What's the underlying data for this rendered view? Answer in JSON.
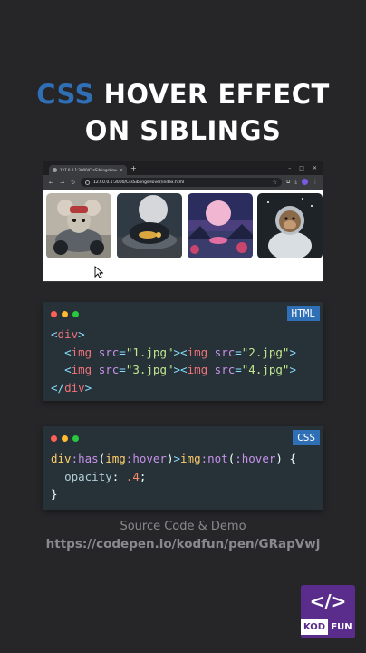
{
  "title": {
    "accent": "CSS",
    "line1_rest": "HOVER EFFECT",
    "line2": "ON SIBLINGS"
  },
  "browser": {
    "tab_title": "127.0.0.1:3000/CssSiblingsHover/",
    "tab_close": "×",
    "new_tab": "+",
    "window_controls": [
      "–",
      "□",
      "✕"
    ],
    "url": "127.0.0.1:3000/CssSiblingsHover/index.html",
    "nav": [
      "←",
      "→",
      "↻"
    ],
    "images": [
      {
        "name": "mouse-racer",
        "colors": [
          "#b9b2a6",
          "#6b6f75",
          "#2b2f33"
        ]
      },
      {
        "name": "moon-coin-vessel",
        "colors": [
          "#2f3a45",
          "#8a8f96",
          "#d9a640"
        ]
      },
      {
        "name": "pink-moon-lake",
        "colors": [
          "#2b2d5e",
          "#e36fa2",
          "#c9456e"
        ]
      },
      {
        "name": "monkey-astronaut",
        "colors": [
          "#1e2328",
          "#8a6a4a",
          "#d9dee3"
        ]
      }
    ]
  },
  "html_card": {
    "badge": "HTML",
    "lines": [
      {
        "open": "<",
        "tag": "div",
        "close": ">"
      },
      {
        "indent": "  ",
        "a_open": "<",
        "a_tag": "img",
        "a_attr": " src",
        "a_eq": "=",
        "a_val": "\"1.jpg\"",
        "a_close": ">",
        "b_open": "<",
        "b_tag": "img",
        "b_attr": " src",
        "b_eq": "=",
        "b_val": "\"2.jpg\"",
        "b_close": ">"
      },
      {
        "indent": "  ",
        "a_open": "<",
        "a_tag": "img",
        "a_attr": " src",
        "a_eq": "=",
        "a_val": "\"3.jpg\"",
        "a_close": ">",
        "b_open": "<",
        "b_tag": "img",
        "b_attr": " src",
        "b_eq": "=",
        "b_val": "\"4.jpg\"",
        "b_close": ">"
      },
      {
        "open": "</",
        "tag": "div",
        "close": ">"
      }
    ]
  },
  "css_card": {
    "badge": "CSS",
    "line1": {
      "s1": "div",
      "p1": ":has",
      "paren1": "(",
      "s2": "img",
      "p2": ":hover",
      "paren2": ")",
      "gt": ">",
      "s3": "img",
      "p3": ":not",
      "paren3": "(",
      "p4": ":hover",
      "paren4": ")",
      "brace": " {"
    },
    "line2": {
      "indent": "  ",
      "prop": "opacity",
      "colon": ": ",
      "num": ".4",
      "semi": ";"
    },
    "line3": {
      "brace": "}"
    }
  },
  "footer": {
    "label": "Source Code & Demo",
    "url": "https://codepen.io/kodfun/pen/GRapVwj"
  },
  "logo": {
    "glyph": "</>",
    "kod": "KOD",
    "fun": "FUN"
  }
}
